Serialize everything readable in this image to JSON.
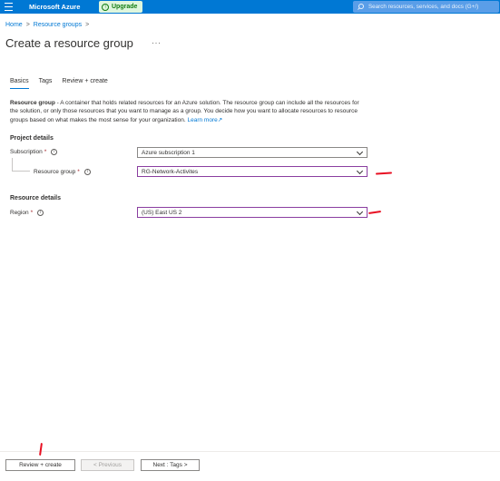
{
  "header": {
    "brand": "Microsoft Azure",
    "upgrade_label": "Upgrade",
    "search_placeholder": "Search resources, services, and docs (G+/)"
  },
  "breadcrumb": [
    {
      "label": "Home"
    },
    {
      "label": "Resource groups"
    }
  ],
  "breadcrumb_separator": ">",
  "page": {
    "title": "Create a resource group",
    "more": "···"
  },
  "tabs": [
    {
      "label": "Basics",
      "active": true
    },
    {
      "label": "Tags",
      "active": false
    },
    {
      "label": "Review + create",
      "active": false
    }
  ],
  "description": {
    "bold": "Resource group",
    "text": " - A container that holds related resources for an Azure solution. The resource group can include all the resources for the solution, or only those resources that you want to manage as a group. You decide how you want to allocate resources to resource groups based on what makes the most sense for your organization. ",
    "link": "Learn more",
    "link_icon": "↗"
  },
  "project_details": {
    "heading": "Project details",
    "subscription": {
      "label": "Subscription",
      "required": "*",
      "value": "Azure subscription 1"
    },
    "resource_group": {
      "label": "Resource group",
      "required": "*",
      "value": "RG-Network-Activites"
    }
  },
  "resource_details": {
    "heading": "Resource details",
    "region": {
      "label": "Region",
      "required": "*",
      "value": "(US) East US 2"
    }
  },
  "info_glyph": "i",
  "footer": {
    "review_create": "Review + create",
    "previous": "< Previous",
    "next": "Next : Tags >"
  },
  "colors": {
    "azure_blue": "#0078d4",
    "upgrade_green": "#107c10",
    "focus_border": "#8a3ea0",
    "annotation_red": "#e81123"
  }
}
